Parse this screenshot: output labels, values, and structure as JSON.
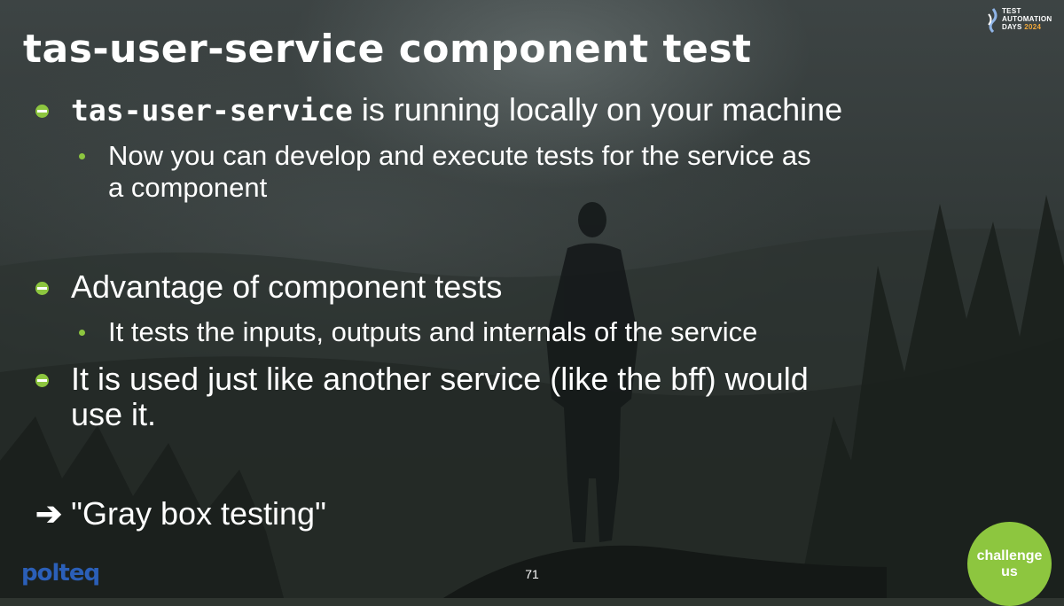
{
  "slide": {
    "title": "tas-user-service component test",
    "bullets": [
      {
        "code": "tas-user-service",
        "text": " is running locally on your machine"
      },
      {
        "sub": [
          "Now you can develop and execute tests for the service as",
          "a component"
        ]
      },
      {
        "text": "Advantage of component tests"
      },
      {
        "sub": [
          "It tests the inputs, outputs and internals of the service"
        ]
      },
      {
        "text_lines": [
          "It is used just like another service (like the bff) would",
          "use it."
        ]
      }
    ],
    "conclusion": {
      "arrow": "➔",
      "text": "\"Gray box testing\""
    },
    "page_number": "71"
  },
  "branding": {
    "polteq_logo": "polteq",
    "challenge_line1": "challenge",
    "challenge_line2": "us",
    "tad_line1": "TEST",
    "tad_line2": "AUTOMATION",
    "tad_line3": "DAYS",
    "tad_year": "2024"
  },
  "colors": {
    "accent_green": "#8dc63f",
    "polteq_blue": "#2b5fb8",
    "year_orange": "#f2a93b"
  }
}
